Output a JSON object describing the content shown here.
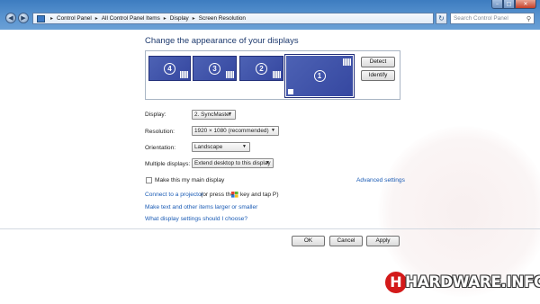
{
  "window": {
    "controls": {
      "minimize": "–",
      "maximize": "□",
      "close": "✕"
    }
  },
  "nav": {
    "back": "◀",
    "forward": "▶"
  },
  "address": {
    "crumbs": [
      "Control Panel",
      "All Control Panel Items",
      "Display",
      "Screen Resolution"
    ],
    "separator": "▸",
    "refresh": "↻"
  },
  "search": {
    "placeholder": "Search Control Panel",
    "icon": "⚲"
  },
  "heading": "Change the appearance of your displays",
  "monitors": [
    {
      "number": "4"
    },
    {
      "number": "3"
    },
    {
      "number": "2"
    },
    {
      "number": "1"
    }
  ],
  "buttons": {
    "detect": "Detect",
    "identify": "Identify",
    "ok": "OK",
    "cancel": "Cancel",
    "apply": "Apply"
  },
  "form": {
    "display": {
      "label": "Display:",
      "value": "2. SyncMaster"
    },
    "resolution": {
      "label": "Resolution:",
      "value": "1920 × 1080 (recommended)"
    },
    "orientation": {
      "label": "Orientation:",
      "value": "Landscape"
    },
    "multiple": {
      "label": "Multiple displays:",
      "value": "Extend desktop to this display"
    },
    "dropdown_arrow": "▼"
  },
  "main_display_checkbox": {
    "label": "Make this my main display",
    "checked": false
  },
  "advanced_link": "Advanced settings",
  "projector": {
    "link": "Connect to a projector",
    "text_before": "(or press the",
    "text_after": "key and tap P)"
  },
  "links": {
    "text_size": "Make text and other items larger or smaller",
    "help": "What display settings should I choose?"
  },
  "watermark": {
    "logo_letter": "H",
    "logo_text": "HARDWARE.INFO"
  }
}
